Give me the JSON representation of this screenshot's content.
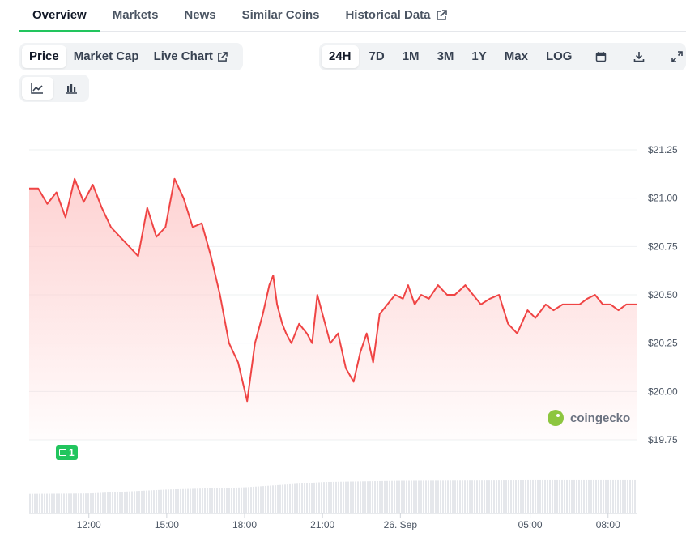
{
  "tabs": [
    {
      "label": "Overview",
      "active": true
    },
    {
      "label": "Markets"
    },
    {
      "label": "News"
    },
    {
      "label": "Similar Coins"
    },
    {
      "label": "Historical Data"
    }
  ],
  "chart_type_buttons": [
    "Price",
    "Market Cap",
    "Live Chart"
  ],
  "range_buttons": [
    "24H",
    "7D",
    "1M",
    "3M",
    "1Y",
    "Max",
    "LOG"
  ],
  "active_range": "24H",
  "watermark": "coingecko",
  "event_badge": "1",
  "colors": {
    "accent": "#22c55e",
    "line": "#ef4444",
    "fill": "#fecaca"
  },
  "chart_data": {
    "type": "area",
    "y_tick_labels": [
      "$21.25",
      "$21.00",
      "$20.75",
      "$20.50",
      "$20.25",
      "$20.00",
      "$19.75"
    ],
    "y_ticks": [
      21.25,
      21.0,
      20.75,
      20.5,
      20.25,
      20.0,
      19.75
    ],
    "ylim": [
      19.75,
      21.25
    ],
    "x_tick_labels": [
      "12:00",
      "15:00",
      "18:00",
      "21:00",
      "26. Sep",
      "05:00",
      "08:00"
    ],
    "x_ticks": [
      12,
      15,
      18,
      21,
      24,
      29,
      32
    ],
    "xlim": [
      9.7,
      33.1
    ],
    "grid": true,
    "legend": "none",
    "series": [
      {
        "x": [
          9.7,
          10.05,
          10.4,
          10.75,
          11.1,
          11.45,
          11.8,
          12.15,
          12.5,
          12.85,
          13.2,
          13.55,
          13.9,
          14.25,
          14.6,
          14.95,
          15.3,
          15.65,
          16.0,
          16.35,
          16.7,
          17.05,
          17.4,
          17.75,
          18.1,
          18.4,
          18.7,
          18.95,
          19.1,
          19.25,
          19.45,
          19.6,
          19.8,
          20.1,
          20.4,
          20.6,
          20.8,
          21.1,
          21.3,
          21.6,
          21.9,
          22.2,
          22.45,
          22.7,
          22.95,
          23.2,
          23.5,
          23.8,
          24.1,
          24.3,
          24.55,
          24.8,
          25.1,
          25.45,
          25.8,
          26.1,
          26.5,
          26.8,
          27.1,
          27.45,
          27.8,
          28.15,
          28.5,
          28.9,
          29.2,
          29.6,
          29.9,
          30.25,
          30.6,
          30.9,
          31.2,
          31.5,
          31.8,
          32.1,
          32.4,
          32.7,
          33.1
        ],
        "values": [
          21.05,
          21.05,
          20.97,
          21.03,
          20.9,
          21.1,
          20.98,
          21.07,
          20.95,
          20.85,
          20.8,
          20.75,
          20.7,
          20.95,
          20.8,
          20.85,
          21.1,
          21.0,
          20.85,
          20.87,
          20.7,
          20.5,
          20.25,
          20.15,
          19.95,
          20.25,
          20.4,
          20.55,
          20.6,
          20.45,
          20.35,
          20.3,
          20.25,
          20.35,
          20.3,
          20.25,
          20.5,
          20.35,
          20.25,
          20.3,
          20.12,
          20.05,
          20.2,
          20.3,
          20.15,
          20.4,
          20.45,
          20.5,
          20.48,
          20.55,
          20.45,
          20.5,
          20.48,
          20.55,
          20.5,
          20.5,
          20.55,
          20.5,
          20.45,
          20.48,
          20.5,
          20.35,
          20.3,
          20.42,
          20.38,
          20.45,
          20.42,
          20.45,
          20.45,
          20.45,
          20.48,
          20.5,
          20.45,
          20.45,
          20.42,
          20.45,
          20.45
        ]
      }
    ],
    "volume_series": {
      "x": [
        9.7,
        12,
        15,
        18,
        21,
        24,
        29,
        33.1
      ],
      "values": [
        0.45,
        0.46,
        0.55,
        0.6,
        0.72,
        0.75,
        0.76,
        0.76
      ]
    }
  }
}
